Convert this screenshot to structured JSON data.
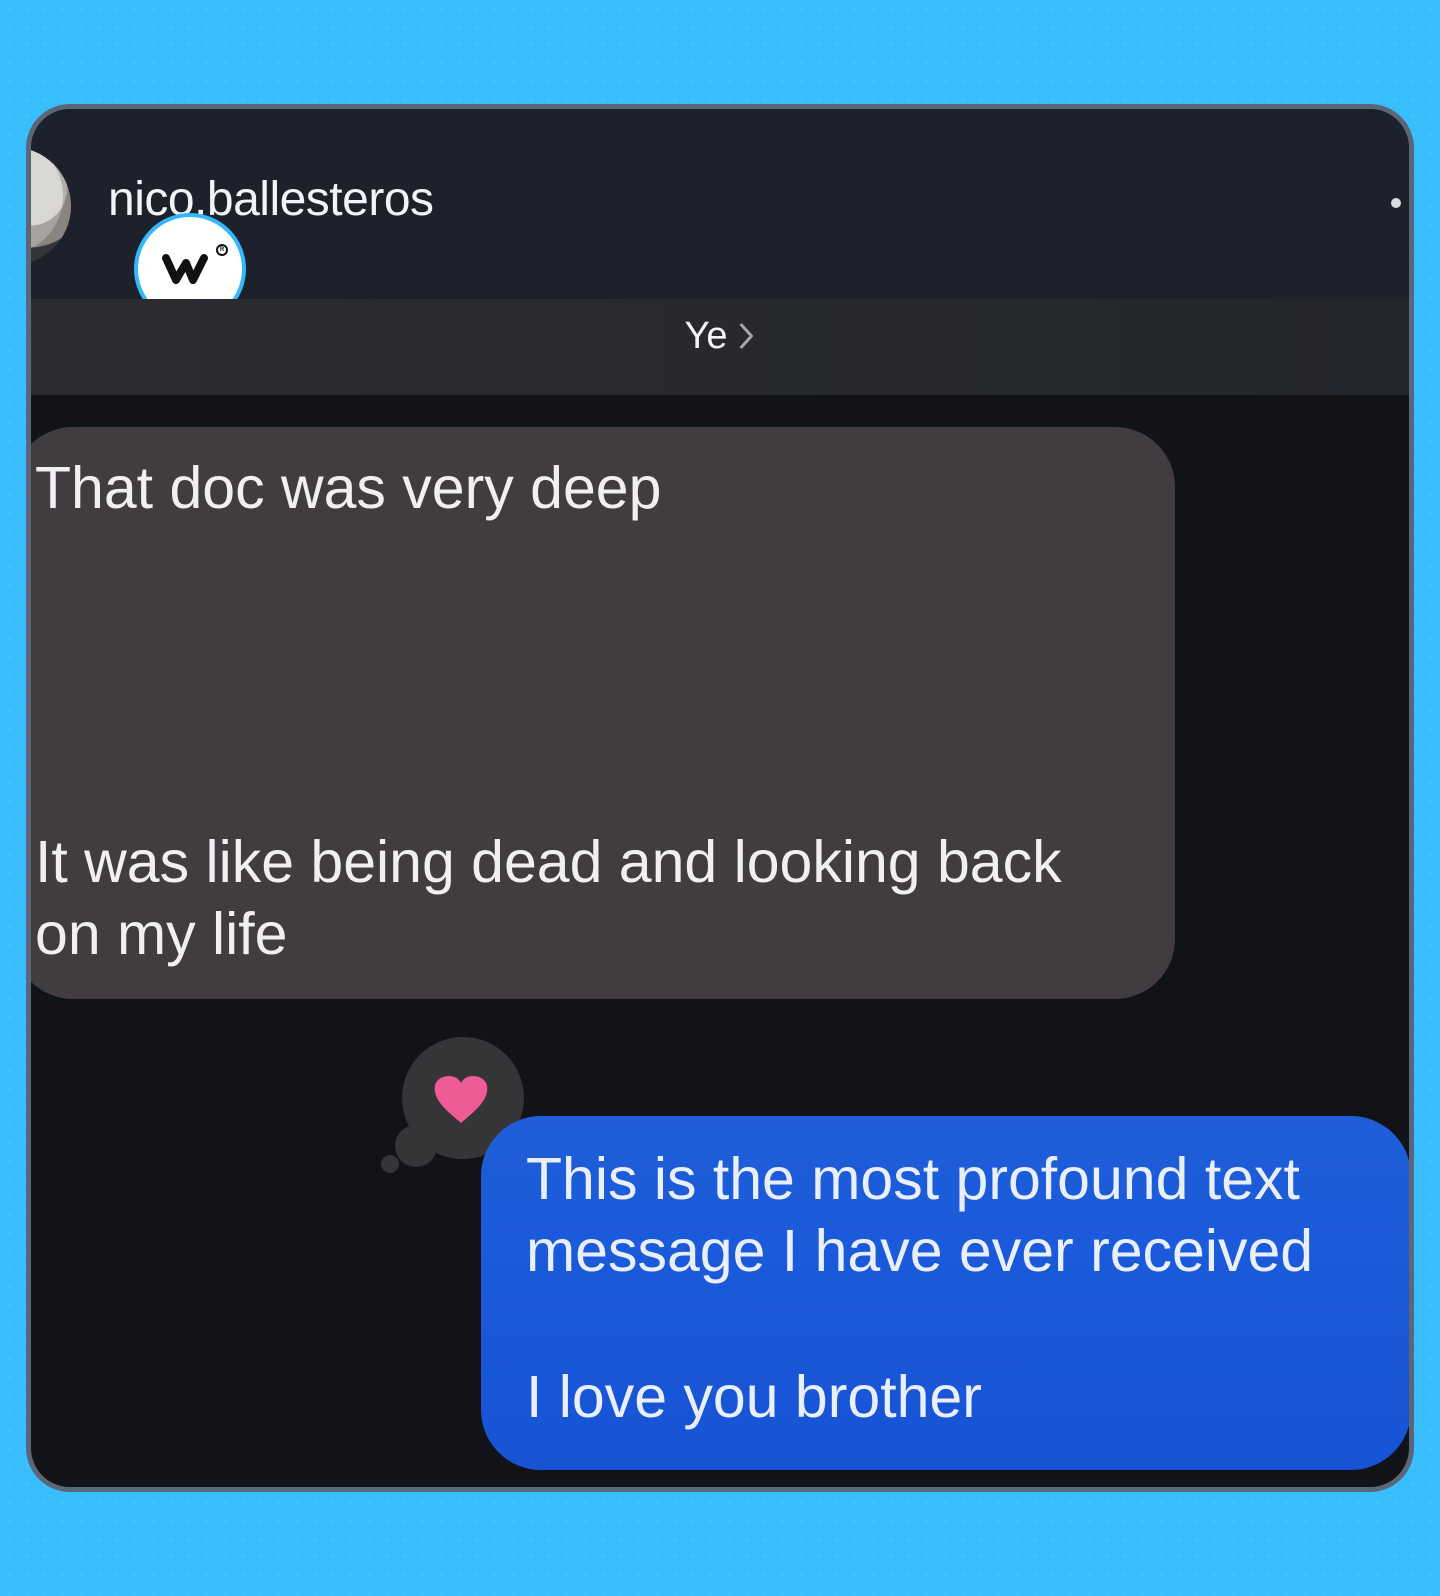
{
  "header": {
    "username": "nico.ballesteros"
  },
  "story": {
    "reply_label": "Ye"
  },
  "messages": {
    "incoming": {
      "line1": "That doc was very deep",
      "line2": "It was like being dead and looking back on my life"
    },
    "outgoing": {
      "line1": "This is the most profound text message I have ever received",
      "line2": "I love you brother"
    }
  },
  "colors": {
    "page_background": "#38bdfd",
    "card_background": "#111319",
    "incoming_bubble": "#403c40",
    "outgoing_bubble": "#1a59da",
    "reaction_heart": "#ef5b94"
  },
  "icons": {
    "logo": "w-logo-icon",
    "story": "chevron-right-icon",
    "reaction": "heart-icon"
  }
}
